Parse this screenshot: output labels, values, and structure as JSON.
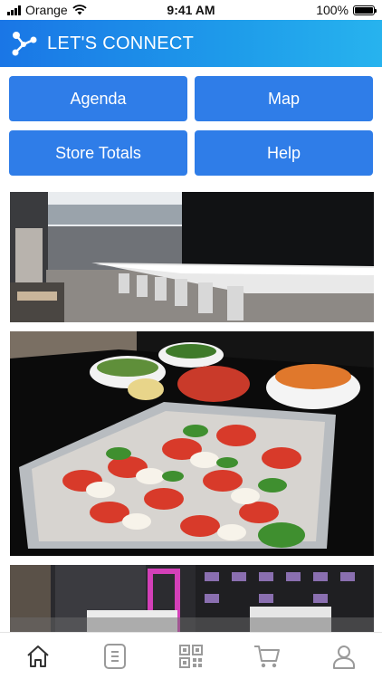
{
  "status_bar": {
    "carrier": "Orange",
    "time": "9:41 AM",
    "battery": "100%"
  },
  "header": {
    "title": "LET'S CONNECT",
    "logo_icon": "network-icon"
  },
  "buttons": [
    {
      "label": "Agenda"
    },
    {
      "label": "Map"
    },
    {
      "label": "Store Totals"
    },
    {
      "label": "Help"
    }
  ],
  "tab_bar": [
    "home-icon",
    "document-icon",
    "qr-code-icon",
    "cart-icon",
    "profile-icon"
  ],
  "colors": {
    "header_start": "#1a76e6",
    "header_end": "#27b3ee",
    "button": "#2f7de8",
    "active_tab": "#333333",
    "inactive_tab": "#9a9a9a"
  }
}
